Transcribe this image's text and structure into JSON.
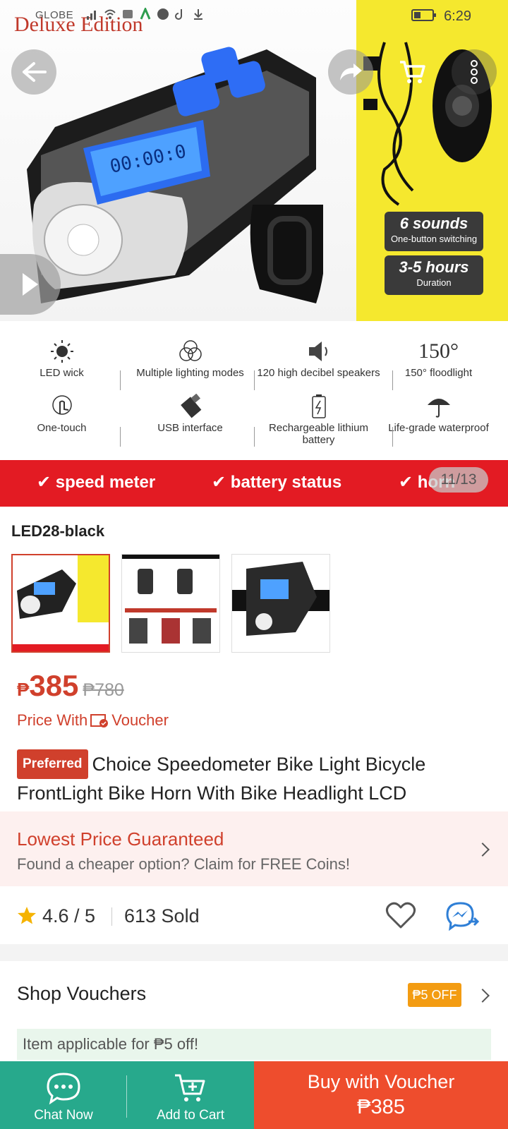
{
  "status_bar": {
    "carrier": "GLOBE",
    "time": "6:29"
  },
  "hero": {
    "brand_text": "Deluxe Edition",
    "badges": [
      {
        "big": "6 sounds",
        "small": "One-button switching"
      },
      {
        "big": "3-5 hours",
        "small": "Duration"
      }
    ],
    "features": [
      {
        "label": "LED wick",
        "icon": "sun-icon"
      },
      {
        "label": "Multiple lighting modes",
        "icon": "rings-icon"
      },
      {
        "label": "120 high decibel speakers",
        "icon": "speaker-icon"
      },
      {
        "label": "150° floodlight",
        "icon": "150-icon",
        "top": "150°"
      },
      {
        "label": "One-touch",
        "icon": "touch-icon"
      },
      {
        "label": "USB interface",
        "icon": "usb-icon"
      },
      {
        "label": "Rechargeable lithium battery",
        "icon": "battery-icon"
      },
      {
        "label": "Life-grade waterproof",
        "icon": "umbrella-icon"
      }
    ],
    "band": [
      "speed meter",
      "battery status",
      "horn"
    ],
    "counter": "11/13"
  },
  "variant": {
    "name": "LED28-black"
  },
  "price": {
    "currency": "₱",
    "current": "385",
    "original": "₱780",
    "voucher_text_pre": "Price With",
    "voucher_text_post": "Voucher"
  },
  "title": {
    "badge": "Preferred",
    "text": "Choice Speedometer Bike Light Bicycle FrontLight Bike Horn With Bike Headlight LCD"
  },
  "guarantee": {
    "title": "Lowest Price Guaranteed",
    "subtitle": "Found a cheaper option? Claim for FREE Coins!"
  },
  "stats": {
    "rating": "4.6 / 5",
    "sold": "613 Sold"
  },
  "vouchers": {
    "label": "Shop Vouchers",
    "tag": "₱5 OFF",
    "applicable": "Item applicable for ₱5 off!"
  },
  "bottom": {
    "chat": "Chat Now",
    "cart": "Add to Cart",
    "buy_line1": "Buy with Voucher",
    "buy_line2": "₱385"
  },
  "colors": {
    "accent": "#ee4d2d",
    "teal": "#27a98c",
    "red_band": "#e31b23",
    "yellow": "#f5e82e"
  }
}
